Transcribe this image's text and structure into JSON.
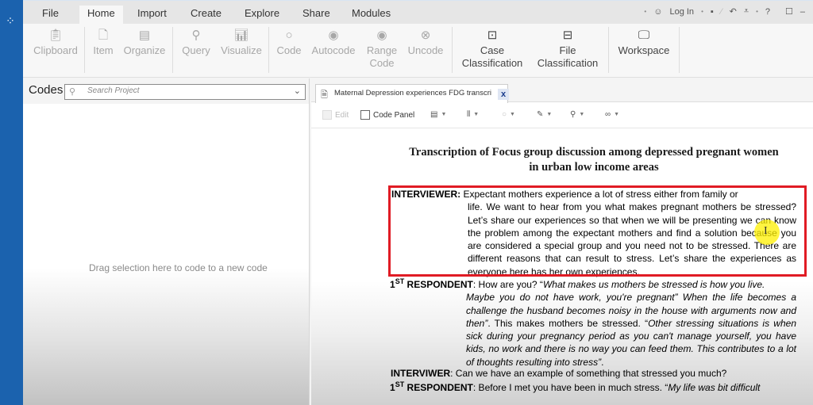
{
  "menubar": {
    "tabs": [
      "File",
      "Home",
      "Import",
      "Create",
      "Explore",
      "Share",
      "Modules"
    ],
    "active_tab": "Home",
    "login_label": "Log In",
    "help_label": "?"
  },
  "ribbon": {
    "clipboard": "Clipboard",
    "item": "Item",
    "organize": "Organize",
    "query": "Query",
    "visualize": "Visualize",
    "code": "Code",
    "autocode": "Autocode",
    "range_code_1": "Range",
    "range_code_2": "Code",
    "uncode": "Uncode",
    "case_class_1": "Case",
    "case_class_2": "Classification",
    "file_class_1": "File",
    "file_class_2": "Classification",
    "workspace": "Workspace"
  },
  "codes_panel": {
    "title": "Codes",
    "search_placeholder": "Search Project",
    "drag_hint": "Drag selection here to code to a new code"
  },
  "document_tab": {
    "label": "Maternal Depression experiences FDG transcri",
    "close": "x"
  },
  "doc_toolbar": {
    "edit_label": "Edit",
    "code_panel_label": "Code Panel"
  },
  "document": {
    "title_line1": "Transcription of Focus group discussion among depressed pregnant women",
    "title_line2": "in urban low income areas",
    "p1_speaker": "INTERVIEWER:",
    "p1_line1": "Expectant mothers experience a lot of stress either from family or",
    "p1_rest": "life. We want to hear from you what makes pregnant mothers be stressed? Let’s share our experiences so that when we will be presenting we can know the problem among the expectant mothers and find a solution because you are considered a special group and you need not to be stressed. There are different reasons that can result to stress. Let’s share the experiences as everyone here has her own experiences.",
    "p2_num": "1",
    "p2_sup": "ST",
    "p2_speaker": "RESPONDENT",
    "p2_lead": ": How are you? “",
    "p2_quote1_first": "What makes us mothers be stressed is how you live.",
    "p2_quote1_rest": "Maybe you do not have work, you're pregnant” When the life becomes a challenge the husband becomes noisy in the house with arguments now and then”",
    "p2_mid": ". This makes mothers be stressed. “",
    "p2_quote2": "Other stressing situations is when sick during your pregnancy period as you can't manage yourself, you have kids, no work and there is no way you can feed them. This contributes to a lot of thoughts resulting into stress”",
    "p2_end": ".",
    "p3_speaker": "INTERVIWER",
    "p3_text": ": Can we have an example of something that stressed you much?",
    "p4_num": "1",
    "p4_sup": "ST",
    "p4_speaker": "RESPONDENT",
    "p4_text": ": Before I met you have been in much stress. “",
    "p4_quote": "My life was bit difficult"
  },
  "colors": {
    "rail_blue": "#1b62ae",
    "highlight_red": "#e01b24",
    "cursor_yellow": "#fff000"
  }
}
